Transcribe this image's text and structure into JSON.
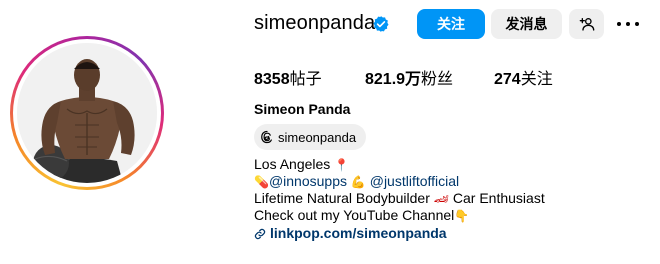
{
  "profile": {
    "username": "simeonpanda",
    "full_name": "Simeon Panda",
    "threads_handle": "simeonpanda"
  },
  "actions": {
    "follow_label": "关注",
    "message_label": "发消息"
  },
  "stats": {
    "posts_value": "8358",
    "posts_label": "帖子",
    "followers_value": "821.9万",
    "followers_label": "粉丝",
    "following_value": "274",
    "following_label": "关注"
  },
  "bio": {
    "location": "Los Angeles",
    "location_emoji": "📍",
    "pill_emoji": "💊",
    "mention1": "@innosupps",
    "muscle_emoji": "💪",
    "mention2": "@justliftofficial",
    "line3_text": "Lifetime Natural Bodybuilder",
    "car_emoji": "🏎",
    "line3_tail": "Car Enthusiast",
    "line4_text": "Check out my YouTube Channel",
    "point_emoji": "👇",
    "link": "linkpop.com/simeonpanda"
  },
  "icons": {
    "verified": "verified-badge-icon",
    "suggest": "add-person-icon",
    "more": "more-options-icon",
    "threads": "threads-logo-icon",
    "link": "link-icon"
  },
  "colors": {
    "primary_blue": "#0095f6",
    "mention_color": "#00376b",
    "button_gray": "#efefef"
  }
}
